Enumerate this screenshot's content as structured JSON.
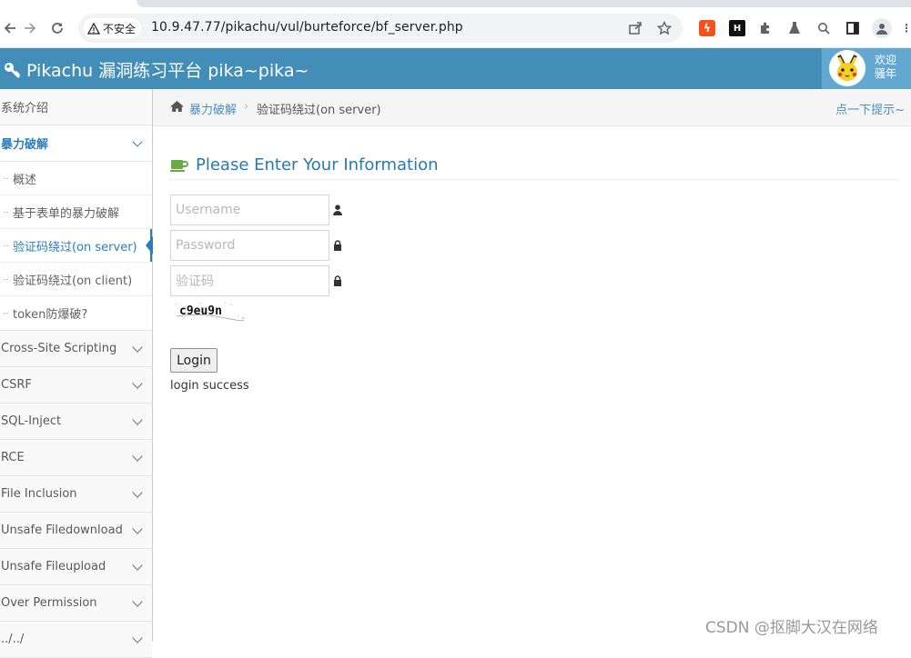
{
  "browser": {
    "security_label": "不安全",
    "url": "10.9.47.77/pikachu/vul/burteforce/bf_server.php"
  },
  "header": {
    "title": "Pikachu 漏洞练习平台 pika~pika~",
    "welcome_line1": "欢迎",
    "welcome_line2": "骚年"
  },
  "sidebar": {
    "items": [
      {
        "label": "系统介绍"
      },
      {
        "label": "暴力破解"
      },
      {
        "label": "Cross-Site Scripting"
      },
      {
        "label": "CSRF"
      },
      {
        "label": "SQL-Inject"
      },
      {
        "label": "RCE"
      },
      {
        "label": "File Inclusion"
      },
      {
        "label": "Unsafe Filedownload"
      },
      {
        "label": "Unsafe Fileupload"
      },
      {
        "label": "Over Permission"
      },
      {
        "label": "../../"
      }
    ],
    "submenu": [
      {
        "label": "概述"
      },
      {
        "label": "基于表单的暴力破解"
      },
      {
        "label": "验证码绕过(on server)"
      },
      {
        "label": "验证码绕过(on client)"
      },
      {
        "label": "token防爆破?"
      }
    ]
  },
  "breadcrumb": {
    "home": "暴力破解",
    "separator": "›",
    "current": "验证码绕过(on server)",
    "hint": "点一下提示~"
  },
  "form": {
    "title": "Please Enter Your Information",
    "username_placeholder": "Username",
    "password_placeholder": "Password",
    "captcha_placeholder": "验证码",
    "captcha_image_text": "c9eu9n",
    "login_label": "Login",
    "result": "login success"
  },
  "watermark": "CSDN @抠脚大汉在网络",
  "colors": {
    "header_bg": "#438eb9",
    "accent": "#2b7dbc",
    "title": "#2679b5"
  }
}
